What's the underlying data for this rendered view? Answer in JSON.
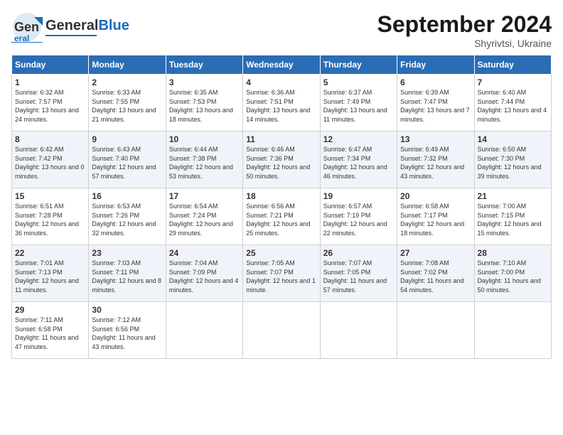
{
  "header": {
    "logo_general": "General",
    "logo_blue": "Blue",
    "month_title": "September 2024",
    "location": "Shyrivtsi, Ukraine"
  },
  "days_of_week": [
    "Sunday",
    "Monday",
    "Tuesday",
    "Wednesday",
    "Thursday",
    "Friday",
    "Saturday"
  ],
  "weeks": [
    [
      {
        "day": "1",
        "sunrise": "Sunrise: 6:32 AM",
        "sunset": "Sunset: 7:57 PM",
        "daylight": "Daylight: 13 hours and 24 minutes."
      },
      {
        "day": "2",
        "sunrise": "Sunrise: 6:33 AM",
        "sunset": "Sunset: 7:55 PM",
        "daylight": "Daylight: 13 hours and 21 minutes."
      },
      {
        "day": "3",
        "sunrise": "Sunrise: 6:35 AM",
        "sunset": "Sunset: 7:53 PM",
        "daylight": "Daylight: 13 hours and 18 minutes."
      },
      {
        "day": "4",
        "sunrise": "Sunrise: 6:36 AM",
        "sunset": "Sunset: 7:51 PM",
        "daylight": "Daylight: 13 hours and 14 minutes."
      },
      {
        "day": "5",
        "sunrise": "Sunrise: 6:37 AM",
        "sunset": "Sunset: 7:49 PM",
        "daylight": "Daylight: 13 hours and 11 minutes."
      },
      {
        "day": "6",
        "sunrise": "Sunrise: 6:39 AM",
        "sunset": "Sunset: 7:47 PM",
        "daylight": "Daylight: 13 hours and 7 minutes."
      },
      {
        "day": "7",
        "sunrise": "Sunrise: 6:40 AM",
        "sunset": "Sunset: 7:44 PM",
        "daylight": "Daylight: 13 hours and 4 minutes."
      }
    ],
    [
      {
        "day": "8",
        "sunrise": "Sunrise: 6:42 AM",
        "sunset": "Sunset: 7:42 PM",
        "daylight": "Daylight: 13 hours and 0 minutes."
      },
      {
        "day": "9",
        "sunrise": "Sunrise: 6:43 AM",
        "sunset": "Sunset: 7:40 PM",
        "daylight": "Daylight: 12 hours and 57 minutes."
      },
      {
        "day": "10",
        "sunrise": "Sunrise: 6:44 AM",
        "sunset": "Sunset: 7:38 PM",
        "daylight": "Daylight: 12 hours and 53 minutes."
      },
      {
        "day": "11",
        "sunrise": "Sunrise: 6:46 AM",
        "sunset": "Sunset: 7:36 PM",
        "daylight": "Daylight: 12 hours and 50 minutes."
      },
      {
        "day": "12",
        "sunrise": "Sunrise: 6:47 AM",
        "sunset": "Sunset: 7:34 PM",
        "daylight": "Daylight: 12 hours and 46 minutes."
      },
      {
        "day": "13",
        "sunrise": "Sunrise: 6:49 AM",
        "sunset": "Sunset: 7:32 PM",
        "daylight": "Daylight: 12 hours and 43 minutes."
      },
      {
        "day": "14",
        "sunrise": "Sunrise: 6:50 AM",
        "sunset": "Sunset: 7:30 PM",
        "daylight": "Daylight: 12 hours and 39 minutes."
      }
    ],
    [
      {
        "day": "15",
        "sunrise": "Sunrise: 6:51 AM",
        "sunset": "Sunset: 7:28 PM",
        "daylight": "Daylight: 12 hours and 36 minutes."
      },
      {
        "day": "16",
        "sunrise": "Sunrise: 6:53 AM",
        "sunset": "Sunset: 7:26 PM",
        "daylight": "Daylight: 12 hours and 32 minutes."
      },
      {
        "day": "17",
        "sunrise": "Sunrise: 6:54 AM",
        "sunset": "Sunset: 7:24 PM",
        "daylight": "Daylight: 12 hours and 29 minutes."
      },
      {
        "day": "18",
        "sunrise": "Sunrise: 6:56 AM",
        "sunset": "Sunset: 7:21 PM",
        "daylight": "Daylight: 12 hours and 25 minutes."
      },
      {
        "day": "19",
        "sunrise": "Sunrise: 6:57 AM",
        "sunset": "Sunset: 7:19 PM",
        "daylight": "Daylight: 12 hours and 22 minutes."
      },
      {
        "day": "20",
        "sunrise": "Sunrise: 6:58 AM",
        "sunset": "Sunset: 7:17 PM",
        "daylight": "Daylight: 12 hours and 18 minutes."
      },
      {
        "day": "21",
        "sunrise": "Sunrise: 7:00 AM",
        "sunset": "Sunset: 7:15 PM",
        "daylight": "Daylight: 12 hours and 15 minutes."
      }
    ],
    [
      {
        "day": "22",
        "sunrise": "Sunrise: 7:01 AM",
        "sunset": "Sunset: 7:13 PM",
        "daylight": "Daylight: 12 hours and 11 minutes."
      },
      {
        "day": "23",
        "sunrise": "Sunrise: 7:03 AM",
        "sunset": "Sunset: 7:11 PM",
        "daylight": "Daylight: 12 hours and 8 minutes."
      },
      {
        "day": "24",
        "sunrise": "Sunrise: 7:04 AM",
        "sunset": "Sunset: 7:09 PM",
        "daylight": "Daylight: 12 hours and 4 minutes."
      },
      {
        "day": "25",
        "sunrise": "Sunrise: 7:05 AM",
        "sunset": "Sunset: 7:07 PM",
        "daylight": "Daylight: 12 hours and 1 minute."
      },
      {
        "day": "26",
        "sunrise": "Sunrise: 7:07 AM",
        "sunset": "Sunset: 7:05 PM",
        "daylight": "Daylight: 11 hours and 57 minutes."
      },
      {
        "day": "27",
        "sunrise": "Sunrise: 7:08 AM",
        "sunset": "Sunset: 7:02 PM",
        "daylight": "Daylight: 11 hours and 54 minutes."
      },
      {
        "day": "28",
        "sunrise": "Sunrise: 7:10 AM",
        "sunset": "Sunset: 7:00 PM",
        "daylight": "Daylight: 11 hours and 50 minutes."
      }
    ],
    [
      {
        "day": "29",
        "sunrise": "Sunrise: 7:11 AM",
        "sunset": "Sunset: 6:58 PM",
        "daylight": "Daylight: 11 hours and 47 minutes."
      },
      {
        "day": "30",
        "sunrise": "Sunrise: 7:12 AM",
        "sunset": "Sunset: 6:56 PM",
        "daylight": "Daylight: 11 hours and 43 minutes."
      },
      null,
      null,
      null,
      null,
      null
    ]
  ]
}
